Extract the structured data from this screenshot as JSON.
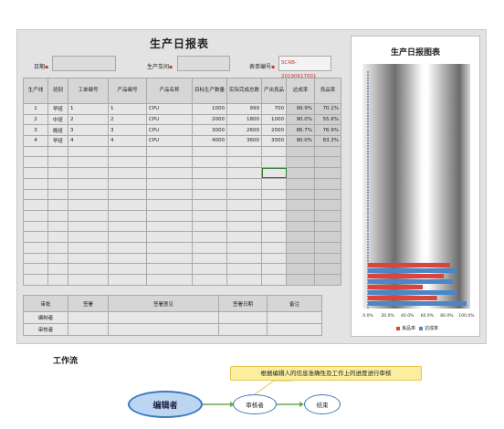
{
  "report": {
    "title": "生产日报表",
    "date_label": "日期",
    "workshop_label": "生产车间",
    "form_no_label": "表单编号",
    "form_no_value": "SCRB-20190617001",
    "columns": [
      "生产线",
      "班别",
      "工单编号",
      "产品编号",
      "产品名称",
      "目标生产数量",
      "实际完成总数",
      "产出良品",
      "达成率",
      "良品率"
    ],
    "rows": [
      [
        "1",
        "早班",
        "1",
        "1",
        "CPU",
        "1000",
        "999",
        "700",
        "99.9%",
        "70.1%"
      ],
      [
        "2",
        "中班",
        "2",
        "2",
        "CPU",
        "2000",
        "1800",
        "1000",
        "90.0%",
        "55.6%"
      ],
      [
        "3",
        "晚班",
        "3",
        "3",
        "CPU",
        "3000",
        "2600",
        "2000",
        "86.7%",
        "76.9%"
      ],
      [
        "4",
        "早班",
        "4",
        "4",
        "CPU",
        "4000",
        "3600",
        "3000",
        "90.0%",
        "83.3%"
      ]
    ],
    "footer_headers": [
      "审批",
      "签署",
      "签署意见",
      "签署日期",
      "备注"
    ],
    "footer_rows": [
      "编制者",
      "审核者"
    ]
  },
  "chart_data": {
    "type": "bar",
    "orientation": "horizontal",
    "title": "生产日报图表",
    "categories": [
      "1",
      "2",
      "3",
      "4"
    ],
    "series": [
      {
        "name": "良品率",
        "color": "#d9453c",
        "values": [
          70.1,
          55.6,
          76.9,
          83.3
        ]
      },
      {
        "name": "达成率",
        "color": "#4a86c8",
        "values": [
          99.9,
          90.0,
          86.7,
          90.0
        ]
      }
    ],
    "xlim": [
      0,
      100
    ],
    "x_ticks": [
      "0.0%",
      "20.0%",
      "40.0%",
      "60.0%",
      "80.0%",
      "100.0%"
    ],
    "legend_position": "bottom"
  },
  "workflow": {
    "title": "工作流",
    "note": "根据编辑人的信息准确性及工作上的进度进行审核",
    "nodes": [
      "编辑者",
      "审核者",
      "结束"
    ]
  }
}
